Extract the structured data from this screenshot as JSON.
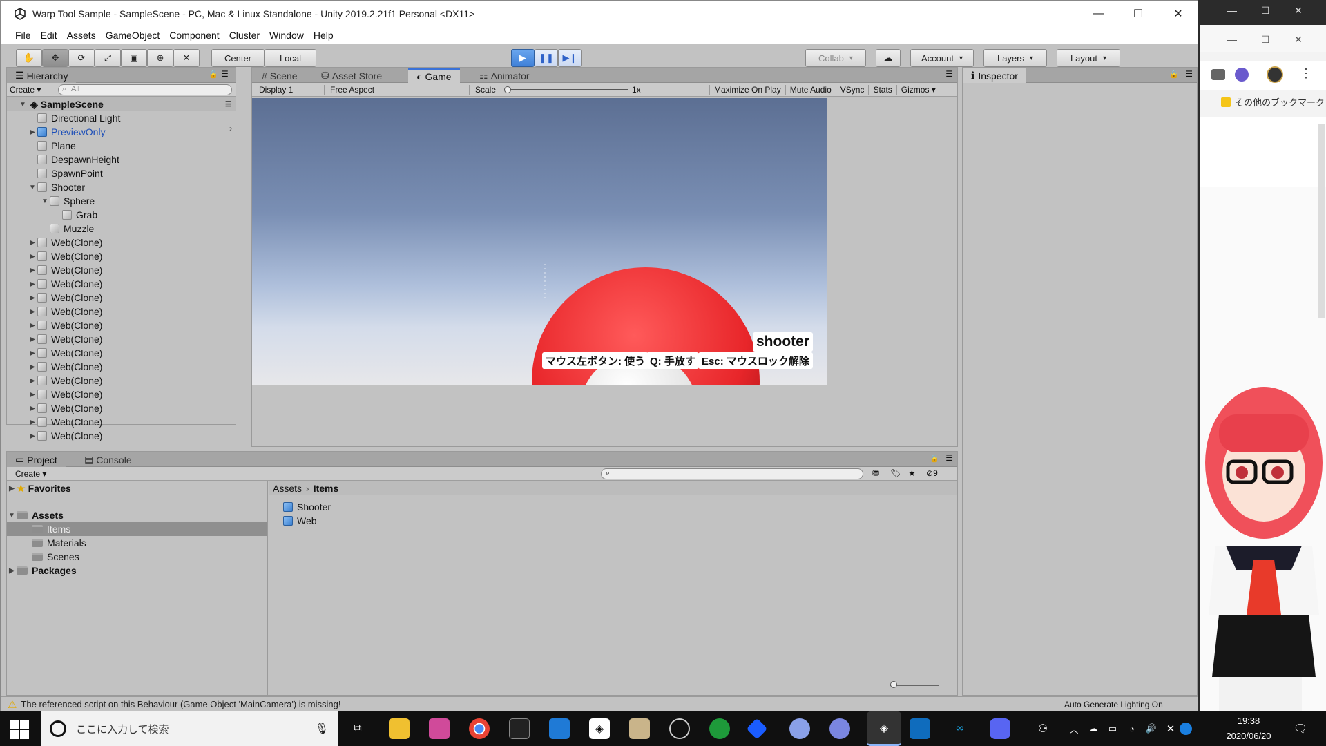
{
  "window": {
    "title": "Warp Tool Sample - SampleScene - PC, Mac & Linux Standalone - Unity 2019.2.21f1 Personal <DX11>",
    "minimize": "—",
    "maximize": "☐",
    "close": "✕"
  },
  "menu": [
    "File",
    "Edit",
    "Assets",
    "GameObject",
    "Component",
    "Cluster",
    "Window",
    "Help"
  ],
  "toolbar": {
    "pivot": "Center",
    "space": "Local",
    "collab": "Collab",
    "account": "Account",
    "layers": "Layers",
    "layout": "Layout"
  },
  "hierarchy": {
    "tab": "Hierarchy",
    "create": "Create",
    "search_placeholder": "All",
    "scene": "SampleScene",
    "items": [
      {
        "label": "Directional Light",
        "depth": 1,
        "arrow": "",
        "blue": false
      },
      {
        "label": "PreviewOnly",
        "depth": 1,
        "arrow": "▶",
        "blue": true
      },
      {
        "label": "Plane",
        "depth": 1,
        "arrow": "",
        "blue": false
      },
      {
        "label": "DespawnHeight",
        "depth": 1,
        "arrow": "",
        "blue": false
      },
      {
        "label": "SpawnPoint",
        "depth": 1,
        "arrow": "",
        "blue": false
      },
      {
        "label": "Shooter",
        "depth": 1,
        "arrow": "▼",
        "blue": false
      },
      {
        "label": "Sphere",
        "depth": 2,
        "arrow": "▼",
        "blue": false
      },
      {
        "label": "Grab",
        "depth": 3,
        "arrow": "",
        "blue": false
      },
      {
        "label": "Muzzle",
        "depth": 2,
        "arrow": "",
        "blue": false
      },
      {
        "label": "Web(Clone)",
        "depth": 1,
        "arrow": "▶",
        "blue": false
      },
      {
        "label": "Web(Clone)",
        "depth": 1,
        "arrow": "▶",
        "blue": false
      },
      {
        "label": "Web(Clone)",
        "depth": 1,
        "arrow": "▶",
        "blue": false
      },
      {
        "label": "Web(Clone)",
        "depth": 1,
        "arrow": "▶",
        "blue": false
      },
      {
        "label": "Web(Clone)",
        "depth": 1,
        "arrow": "▶",
        "blue": false
      },
      {
        "label": "Web(Clone)",
        "depth": 1,
        "arrow": "▶",
        "blue": false
      },
      {
        "label": "Web(Clone)",
        "depth": 1,
        "arrow": "▶",
        "blue": false
      },
      {
        "label": "Web(Clone)",
        "depth": 1,
        "arrow": "▶",
        "blue": false
      },
      {
        "label": "Web(Clone)",
        "depth": 1,
        "arrow": "▶",
        "blue": false
      },
      {
        "label": "Web(Clone)",
        "depth": 1,
        "arrow": "▶",
        "blue": false
      },
      {
        "label": "Web(Clone)",
        "depth": 1,
        "arrow": "▶",
        "blue": false
      },
      {
        "label": "Web(Clone)",
        "depth": 1,
        "arrow": "▶",
        "blue": false
      },
      {
        "label": "Web(Clone)",
        "depth": 1,
        "arrow": "▶",
        "blue": false
      },
      {
        "label": "Web(Clone)",
        "depth": 1,
        "arrow": "▶",
        "blue": false
      },
      {
        "label": "Web(Clone)",
        "depth": 1,
        "arrow": "▶",
        "blue": false
      }
    ]
  },
  "center_tabs": {
    "scene": "Scene",
    "asset_store": "Asset Store",
    "game": "Game",
    "animator": "Animator"
  },
  "game_bar": {
    "display": "Display 1",
    "aspect": "Free Aspect",
    "scale_label": "Scale",
    "scale_value": "1x",
    "scale_level": 0.0,
    "maximize": "Maximize On Play",
    "mute": "Mute Audio",
    "vsync": "VSync",
    "stats": "Stats",
    "gizmos": "Gizmos"
  },
  "game_ui": {
    "item_name": "shooter",
    "hint_use": "マウス左ボタン: 使う",
    "hint_release": "Q: 手放す",
    "hint_unlock": "Esc: マウスロック解除"
  },
  "inspector": {
    "tab": "Inspector"
  },
  "project": {
    "tab_project": "Project",
    "tab_console": "Console",
    "create": "Create",
    "tree": {
      "favorites": "Favorites",
      "assets": "Assets",
      "items": "Items",
      "materials": "Materials",
      "scenes": "Scenes",
      "packages": "Packages"
    },
    "breadcrumb_root": "Assets",
    "breadcrumb_current": "Items",
    "files": [
      "Shooter",
      "Web"
    ],
    "hidden_count": "9"
  },
  "status": {
    "warning": "The referenced script on this Behaviour (Game Object 'MainCamera') is missing!",
    "lighting": "Auto Generate Lighting On"
  },
  "browser": {
    "bookmark": "その他のブックマーク"
  },
  "taskbar": {
    "search_placeholder": "ここに入力して検索",
    "time": "19:38",
    "date": "2020/06/20"
  },
  "colors": {
    "accent": "#3a72d8",
    "ball": "#e8262a",
    "play": "#4a8be0"
  }
}
